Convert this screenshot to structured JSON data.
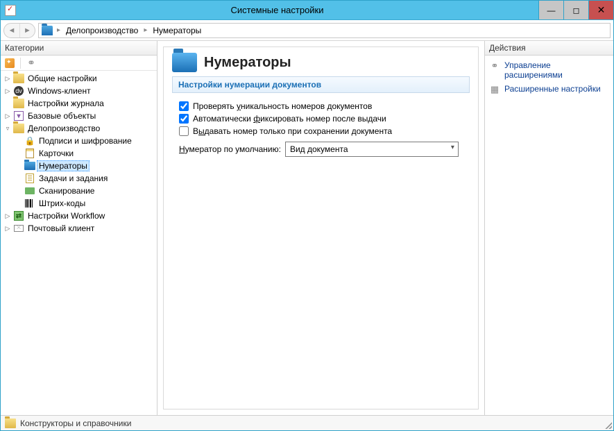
{
  "window": {
    "title": "Системные настройки"
  },
  "breadcrumb": {
    "item1": "Делопроизводство",
    "item2": "Нумераторы"
  },
  "leftPanel": {
    "header": "Категории"
  },
  "rightPanel": {
    "header": "Действия"
  },
  "tree": {
    "general": "Общие настройки",
    "winclient": "Windows-клиент",
    "journal": "Настройки журнала",
    "baseobj": "Базовые объекты",
    "deloproc": "Делопроизводство",
    "signing": "Подписи и шифрование",
    "cards": "Карточки",
    "numerators": "Нумераторы",
    "tasks": "Задачи и задания",
    "scanning": "Сканирование",
    "barcodes": "Штрих-коды",
    "workflow": "Настройки Workflow",
    "mail": "Почтовый клиент"
  },
  "page": {
    "title": "Нумераторы",
    "section": "Настройки нумерации документов",
    "check1_pre": "Проверять ",
    "check1_u": "у",
    "check1_post": "никальность номеров документов",
    "check2_pre": "Автоматически ",
    "check2_u": "ф",
    "check2_post": "иксировать номер после выдачи",
    "check3_pre": "В",
    "check3_u": "ы",
    "check3_post": "давать номер только при сохранении документа",
    "combo_label_pre": "",
    "combo_label_u": "Н",
    "combo_label_post": "умератор по умолчанию:",
    "combo_value": "Вид документа"
  },
  "actions": {
    "a1": "Управление расширениями",
    "a2": "Расширенные настройки"
  },
  "status": {
    "text": "Конструкторы и справочники"
  }
}
